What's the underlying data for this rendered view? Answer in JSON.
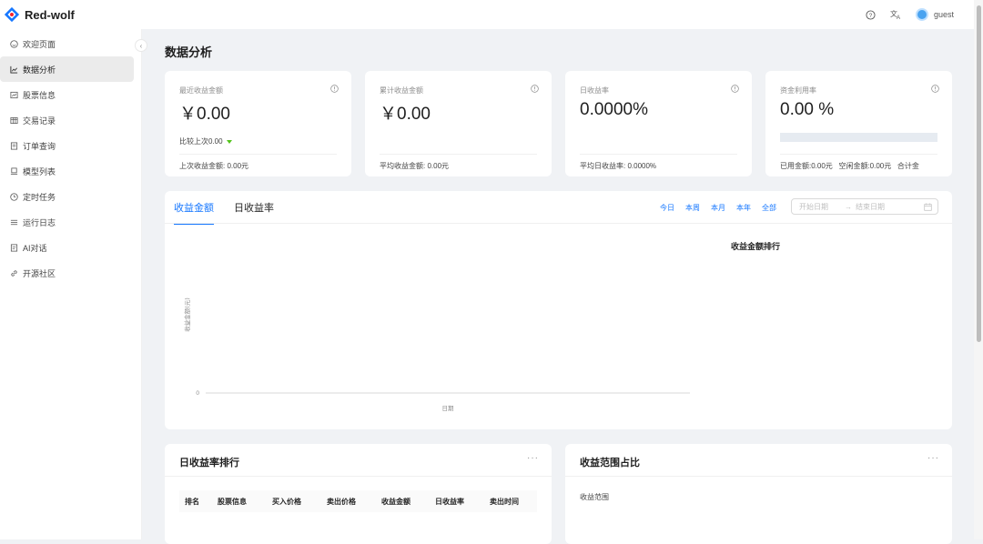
{
  "app": {
    "name": "Red-wolf",
    "user": "guest"
  },
  "header": {
    "icons": [
      "help-icon",
      "translate-icon"
    ]
  },
  "sidebar": {
    "items": [
      {
        "label": "欢迎页面",
        "icon": "smile-icon",
        "active": false
      },
      {
        "label": "数据分析",
        "icon": "line-chart-icon",
        "active": true
      },
      {
        "label": "股票信息",
        "icon": "stock-icon",
        "active": false
      },
      {
        "label": "交易记录",
        "icon": "table-icon",
        "active": false
      },
      {
        "label": "订单查询",
        "icon": "order-icon",
        "active": false
      },
      {
        "label": "模型列表",
        "icon": "model-icon",
        "active": false
      },
      {
        "label": "定时任务",
        "icon": "clock-icon",
        "active": false
      },
      {
        "label": "运行日志",
        "icon": "list-icon",
        "active": false
      },
      {
        "label": "AI对话",
        "icon": "chat-icon",
        "active": false
      },
      {
        "label": "开源社区",
        "icon": "link-icon",
        "active": false
      }
    ]
  },
  "page": {
    "title": "数据分析"
  },
  "stats": [
    {
      "label": "最近收益金额",
      "value": "￥0.00",
      "compare": "比较上次0.00",
      "footer": "上次收益金额: 0.00元"
    },
    {
      "label": "累计收益金额",
      "value": "￥0.00",
      "footer": "平均收益金额: 0.00元"
    },
    {
      "label": "日收益率",
      "value": "0.0000%",
      "footer": "平均日收益率: 0.0000%"
    },
    {
      "label": "资金利用率",
      "value": "0.00 %",
      "progress": 0,
      "footer": "已用金额:0.00元   空闲金额:0.00元   合计金"
    }
  ],
  "chart_panel": {
    "tabs": [
      "收益金额",
      "日收益率"
    ],
    "active_tab": 0,
    "ranges": [
      "今日",
      "本周",
      "本月",
      "本年",
      "全部"
    ],
    "start_placeholder": "开始日期",
    "end_placeholder": "结束日期",
    "arrow": "→",
    "rank_title": "收益金额排行"
  },
  "chart_data": {
    "type": "line",
    "x": [],
    "series": [],
    "xlabel": "日期",
    "ylabel": "收益金额(元)",
    "yticks": [
      "0"
    ]
  },
  "table_panel": {
    "title": "日收益率排行",
    "more": "···",
    "columns": [
      "排名",
      "股票信息",
      "买入价格",
      "卖出价格",
      "收益金额",
      "日收益率",
      "卖出时间"
    ]
  },
  "pie_panel": {
    "title": "收益范围占比",
    "more": "···",
    "label": "收益范围"
  },
  "colors": {
    "accent": "#1677ff",
    "up": "#52c41a"
  }
}
